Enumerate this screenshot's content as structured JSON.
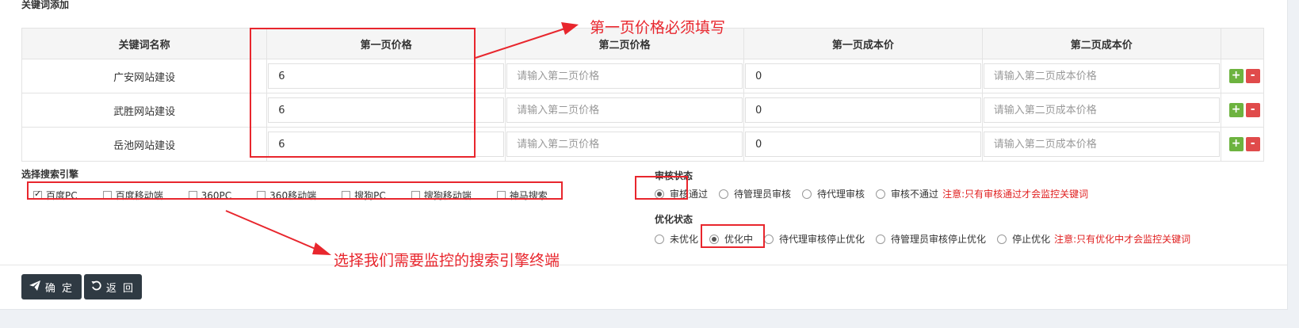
{
  "section_title": "关键词添加",
  "table": {
    "headers": [
      "关键词名称",
      "第一页价格",
      "第二页价格",
      "第一页成本价",
      "第二页成本价"
    ],
    "rows": [
      {
        "name": "广安网站建设",
        "p1": "6",
        "p2_placeholder": "请输入第二页价格",
        "c1": "0",
        "c2_placeholder": "请输入第二页成本价格"
      },
      {
        "name": "武胜网站建设",
        "p1": "6",
        "p2_placeholder": "请输入第二页价格",
        "c1": "0",
        "c2_placeholder": "请输入第二页成本价格"
      },
      {
        "name": "岳池网站建设",
        "p1": "6",
        "p2_placeholder": "请输入第二页价格",
        "c1": "0",
        "c2_placeholder": "请输入第二页成本价格"
      }
    ],
    "add_symbol": "+",
    "remove_symbol": "-"
  },
  "engines": {
    "label": "选择搜索引擎",
    "options": [
      {
        "label": "百度PC",
        "checked": true
      },
      {
        "label": "百度移动端",
        "checked": false
      },
      {
        "label": "360PC",
        "checked": false
      },
      {
        "label": "360移动端",
        "checked": false
      },
      {
        "label": "搜狗PC",
        "checked": false
      },
      {
        "label": "搜狗移动端",
        "checked": false
      },
      {
        "label": "神马搜索",
        "checked": false
      }
    ]
  },
  "audit": {
    "label": "审核状态",
    "options": [
      {
        "label": "审核通过",
        "selected": true
      },
      {
        "label": "待管理员审核",
        "selected": false
      },
      {
        "label": "待代理审核",
        "selected": false
      },
      {
        "label": "审核不通过",
        "selected": false
      }
    ],
    "note": "注意:只有审核通过才会监控关键词"
  },
  "optimize": {
    "label": "优化状态",
    "options": [
      {
        "label": "未优化",
        "selected": false
      },
      {
        "label": "优化中",
        "selected": true
      },
      {
        "label": "待代理审核停止优化",
        "selected": false
      },
      {
        "label": "待管理员审核停止优化",
        "selected": false
      },
      {
        "label": "停止优化",
        "selected": false
      }
    ],
    "note": "注意:只有优化中才会监控关键词"
  },
  "buttons": {
    "confirm": "确 定",
    "back": "返 回",
    "confirm_icon": "paper-plane-icon",
    "back_icon": "undo-icon"
  },
  "annotations": {
    "price_note": "第一页价格必须填写",
    "engine_note": "选择我们需要监控的搜索引擎终端",
    "color": "#e8262d"
  }
}
